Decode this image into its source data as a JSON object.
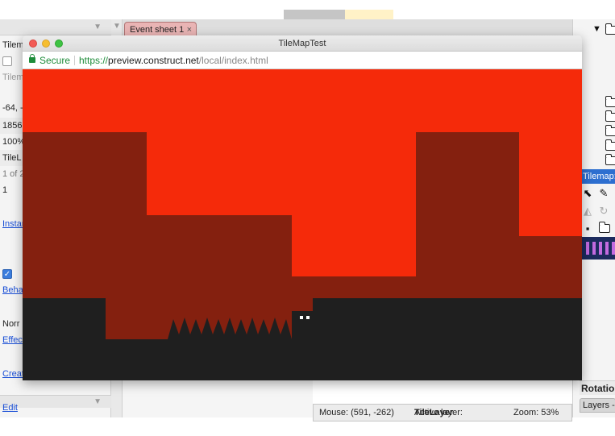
{
  "editor": {
    "left_panel": {
      "rows": [
        "Tilem",
        "",
        "Tilem",
        "-64, -",
        "1856",
        "100%",
        "TileL",
        "1 of 2",
        "1",
        "Instan",
        "Behav",
        "Norr",
        "Effec",
        "Creat",
        "Edit"
      ],
      "links": {
        "instances": "Instan",
        "behaviors": "Behav",
        "effects": "Effec",
        "create": "Creat",
        "edit": "Edit"
      }
    },
    "tab": {
      "label": "Event sheet 1",
      "close": "×"
    },
    "right_panel": {
      "tilemap_header": "Tilemap: ",
      "rotation_label": "Rotation",
      "layers_tab": "Layers -"
    },
    "status_bar": {
      "mouse": "Mouse: (591, -262)",
      "active_layer_prefix": "Active layer: ",
      "active_layer_name": "TileLayer",
      "zoom": "Zoom: 53%"
    }
  },
  "preview_window": {
    "title": "TileMapTest",
    "secure_label": "Secure",
    "url_scheme": "https://",
    "url_host": "preview.construct.net",
    "url_path": "/local/index.html"
  },
  "colors": {
    "sky": "#f52a0a",
    "wall": "#84200f",
    "ground": "#1f1f1f",
    "player": "#1f1f1f",
    "player_eyes": "#ffffff"
  }
}
